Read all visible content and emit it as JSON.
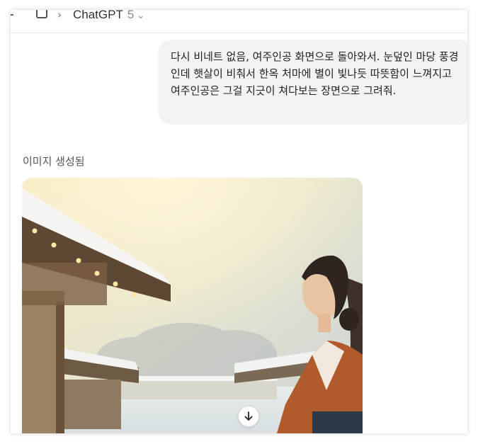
{
  "header": {
    "model_name": "ChatGPT",
    "model_version": "5",
    "breadcrumb_separator": "›",
    "icons": [
      "sidebar-toggle-icon",
      "panel-icon",
      "chevron-down-icon"
    ]
  },
  "conversation": {
    "user_message": "다시 비네트 없음, 여주인공 화면으로 돌아와서. 눈덮인 마당 풍경인데 햇살이 비춰서 한옥 처마에 별이 빛나듯 따뜻함이 느껴지고 여주인공은 그걸 지긋이 쳐다보는 장면으로 그려줘.",
    "assistant_status": "이미지 생성됨",
    "generated_image_icon": "generated-image",
    "scroll_button_icon": "arrow-down-icon"
  }
}
